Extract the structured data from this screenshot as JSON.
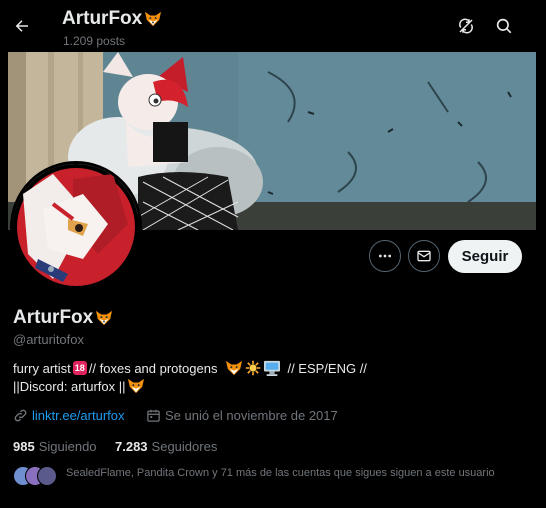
{
  "header": {
    "title": "ArturFox",
    "posts": "1.209 posts"
  },
  "profile": {
    "name": "ArturFox",
    "handle": "@arturitofox",
    "bio_line1_a": "furry artist",
    "bio_line1_b": "// foxes and protogens",
    "bio_line1_c": "// ESP/ENG //",
    "bio_line2_a": "||Discord: arturfox ||",
    "link": "linktr.ee/arturfox",
    "joined": "Se unió el noviembre de 2017",
    "following_count": "985",
    "following_label": "Siguiendo",
    "followers_count": "7.283",
    "followers_label": "Seguidores",
    "followed_by": "SealedFlame, Pandita Crown y 71 más de las cuentas que sigues siguen a este usuario"
  },
  "actions": {
    "follow_label": "Seguir"
  },
  "colors": {
    "background": "#000000",
    "link": "#1d9bf0",
    "muted": "#71767b",
    "text": "#e7e9ea",
    "follow_bg": "#eff3f4"
  },
  "icons": {
    "back": "arrow-left-icon",
    "refresh": "refresh-slash-icon",
    "search": "search-icon",
    "more": "more-horizontal-icon",
    "message": "envelope-icon",
    "link": "link-icon",
    "calendar": "calendar-icon"
  }
}
